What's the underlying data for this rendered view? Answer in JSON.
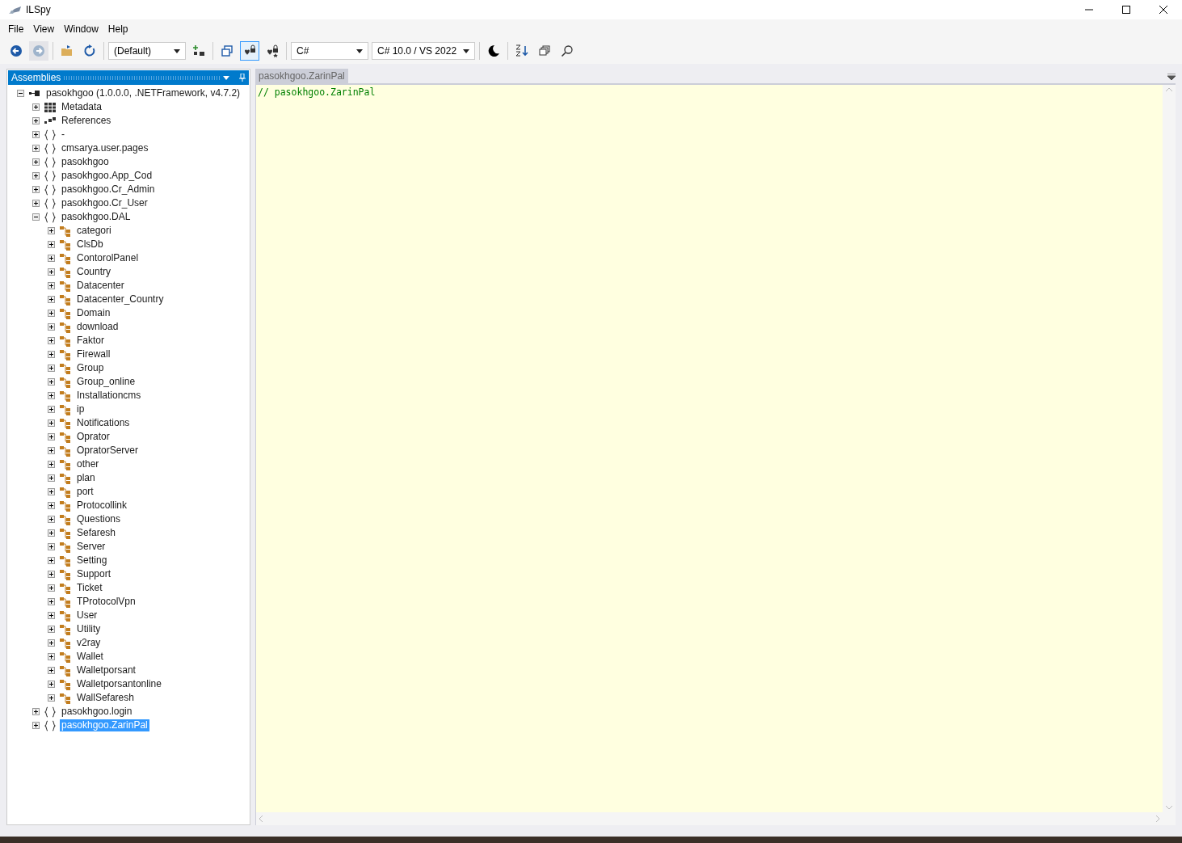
{
  "window": {
    "title": "ILSpy"
  },
  "menu": [
    "File",
    "View",
    "Window",
    "Help"
  ],
  "toolbar": [
    {
      "kind": "button",
      "disabled": false,
      "pressed": false
    },
    {
      "kind": "button",
      "disabled": true,
      "pressed": false
    },
    {
      "kind": "separator"
    },
    {
      "kind": "button",
      "disabled": false,
      "pressed": false
    },
    {
      "kind": "button",
      "disabled": false,
      "pressed": false
    },
    {
      "kind": "separator"
    },
    {
      "kind": "dropdown",
      "value": "(Default)"
    },
    {
      "kind": "button",
      "disabled": false,
      "pressed": false
    },
    {
      "kind": "separator"
    },
    {
      "kind": "button",
      "disabled": false,
      "pressed": false
    },
    {
      "kind": "button",
      "disabled": false,
      "pressed": true
    },
    {
      "kind": "button",
      "disabled": false,
      "pressed": false
    },
    {
      "kind": "separator"
    },
    {
      "kind": "dropdown",
      "value": "C#"
    },
    {
      "kind": "dropdown",
      "value": "C# 10.0 / VS 2022"
    },
    {
      "kind": "separator"
    },
    {
      "kind": "button",
      "disabled": false,
      "pressed": false
    },
    {
      "kind": "separator"
    },
    {
      "kind": "button",
      "disabled": false,
      "pressed": false
    },
    {
      "kind": "button",
      "disabled": false,
      "pressed": false
    },
    {
      "kind": "button",
      "disabled": false,
      "pressed": false
    }
  ],
  "assemblies_panel": {
    "title": "Assemblies",
    "tree": [
      {
        "kind": "assembly",
        "label": "pasokhgoo (1.0.0.0, .NETFramework, v4.7.2)",
        "expanded": true,
        "selected": false,
        "children": [
          {
            "kind": "metadata",
            "label": "Metadata",
            "expanded": false,
            "selected": false
          },
          {
            "kind": "references",
            "label": "References",
            "expanded": false,
            "selected": false
          },
          {
            "kind": "namespace",
            "label": "-",
            "expanded": false,
            "selected": false
          },
          {
            "kind": "namespace",
            "label": "cmsarya.user.pages",
            "expanded": false,
            "selected": false
          },
          {
            "kind": "namespace",
            "label": "pasokhgoo",
            "expanded": false,
            "selected": false
          },
          {
            "kind": "namespace",
            "label": "pasokhgoo.App_Cod",
            "expanded": false,
            "selected": false
          },
          {
            "kind": "namespace",
            "label": "pasokhgoo.Cr_Admin",
            "expanded": false,
            "selected": false
          },
          {
            "kind": "namespace",
            "label": "pasokhgoo.Cr_User",
            "expanded": false,
            "selected": false
          },
          {
            "kind": "namespace",
            "label": "pasokhgoo.DAL",
            "expanded": true,
            "selected": false,
            "children": [
              {
                "kind": "class",
                "label": "categori",
                "expanded": false,
                "selected": false
              },
              {
                "kind": "class",
                "label": "ClsDb",
                "expanded": false,
                "selected": false
              },
              {
                "kind": "class",
                "label": "ContorolPanel",
                "expanded": false,
                "selected": false
              },
              {
                "kind": "class",
                "label": "Country",
                "expanded": false,
                "selected": false
              },
              {
                "kind": "class",
                "label": "Datacenter",
                "expanded": false,
                "selected": false
              },
              {
                "kind": "class",
                "label": "Datacenter_Country",
                "expanded": false,
                "selected": false
              },
              {
                "kind": "class",
                "label": "Domain",
                "expanded": false,
                "selected": false
              },
              {
                "kind": "class",
                "label": "download",
                "expanded": false,
                "selected": false
              },
              {
                "kind": "class",
                "label": "Faktor",
                "expanded": false,
                "selected": false
              },
              {
                "kind": "class",
                "label": "Firewall",
                "expanded": false,
                "selected": false
              },
              {
                "kind": "class",
                "label": "Group",
                "expanded": false,
                "selected": false
              },
              {
                "kind": "class",
                "label": "Group_online",
                "expanded": false,
                "selected": false
              },
              {
                "kind": "class",
                "label": "Installationcms",
                "expanded": false,
                "selected": false
              },
              {
                "kind": "class",
                "label": "ip",
                "expanded": false,
                "selected": false
              },
              {
                "kind": "class",
                "label": "Notifications",
                "expanded": false,
                "selected": false
              },
              {
                "kind": "class",
                "label": "Oprator",
                "expanded": false,
                "selected": false
              },
              {
                "kind": "class",
                "label": "OpratorServer",
                "expanded": false,
                "selected": false
              },
              {
                "kind": "class",
                "label": "other",
                "expanded": false,
                "selected": false
              },
              {
                "kind": "class",
                "label": "plan",
                "expanded": false,
                "selected": false
              },
              {
                "kind": "class",
                "label": "port",
                "expanded": false,
                "selected": false
              },
              {
                "kind": "class",
                "label": "Protocollink",
                "expanded": false,
                "selected": false
              },
              {
                "kind": "class",
                "label": "Questions",
                "expanded": false,
                "selected": false
              },
              {
                "kind": "class",
                "label": "Sefaresh",
                "expanded": false,
                "selected": false
              },
              {
                "kind": "class",
                "label": "Server",
                "expanded": false,
                "selected": false
              },
              {
                "kind": "class",
                "label": "Setting",
                "expanded": false,
                "selected": false
              },
              {
                "kind": "class",
                "label": "Support",
                "expanded": false,
                "selected": false
              },
              {
                "kind": "class",
                "label": "Ticket",
                "expanded": false,
                "selected": false
              },
              {
                "kind": "class",
                "label": "TProtocolVpn",
                "expanded": false,
                "selected": false
              },
              {
                "kind": "class",
                "label": "User",
                "expanded": false,
                "selected": false
              },
              {
                "kind": "class",
                "label": "Utility",
                "expanded": false,
                "selected": false
              },
              {
                "kind": "class",
                "label": "v2ray",
                "expanded": false,
                "selected": false
              },
              {
                "kind": "class",
                "label": "Wallet",
                "expanded": false,
                "selected": false
              },
              {
                "kind": "class",
                "label": "Walletporsant",
                "expanded": false,
                "selected": false
              },
              {
                "kind": "class",
                "label": "Walletporsantonline",
                "expanded": false,
                "selected": false
              },
              {
                "kind": "class",
                "label": "WallSefaresh",
                "expanded": false,
                "selected": false
              }
            ]
          },
          {
            "kind": "namespace",
            "label": "pasokhgoo.login",
            "expanded": false,
            "selected": false
          },
          {
            "kind": "namespace",
            "label": "pasokhgoo.ZarinPal",
            "expanded": false,
            "selected": true
          }
        ]
      }
    ]
  },
  "editor": {
    "tab": "pasokhgoo.ZarinPal",
    "code": "// pasokhgoo.ZarinPal"
  }
}
